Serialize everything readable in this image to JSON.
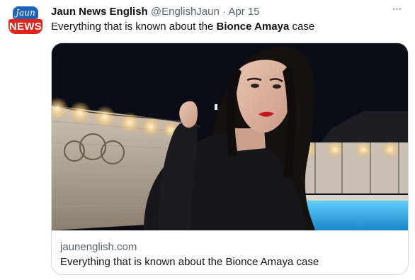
{
  "author": {
    "display_name": "Jaun News English",
    "handle": "@EnglishJaun",
    "separator": "·",
    "date": "Apr 15",
    "logo_text_top": "Jaun",
    "logo_text_bottom": "NEWS"
  },
  "tweet": {
    "text_before": "Everything that is known about the ",
    "text_bold": "Bionce Amaya",
    "text_after": " case"
  },
  "card": {
    "domain": "jaunenglish.com",
    "title": "Everything that is known about the Bionce Amaya case"
  },
  "icons": {
    "more": "more-options-icon"
  },
  "colors": {
    "logo_blue": "#1f63b5",
    "logo_red": "#e2231a",
    "secondary_text": "#536471",
    "card_border": "#cfd9de"
  }
}
